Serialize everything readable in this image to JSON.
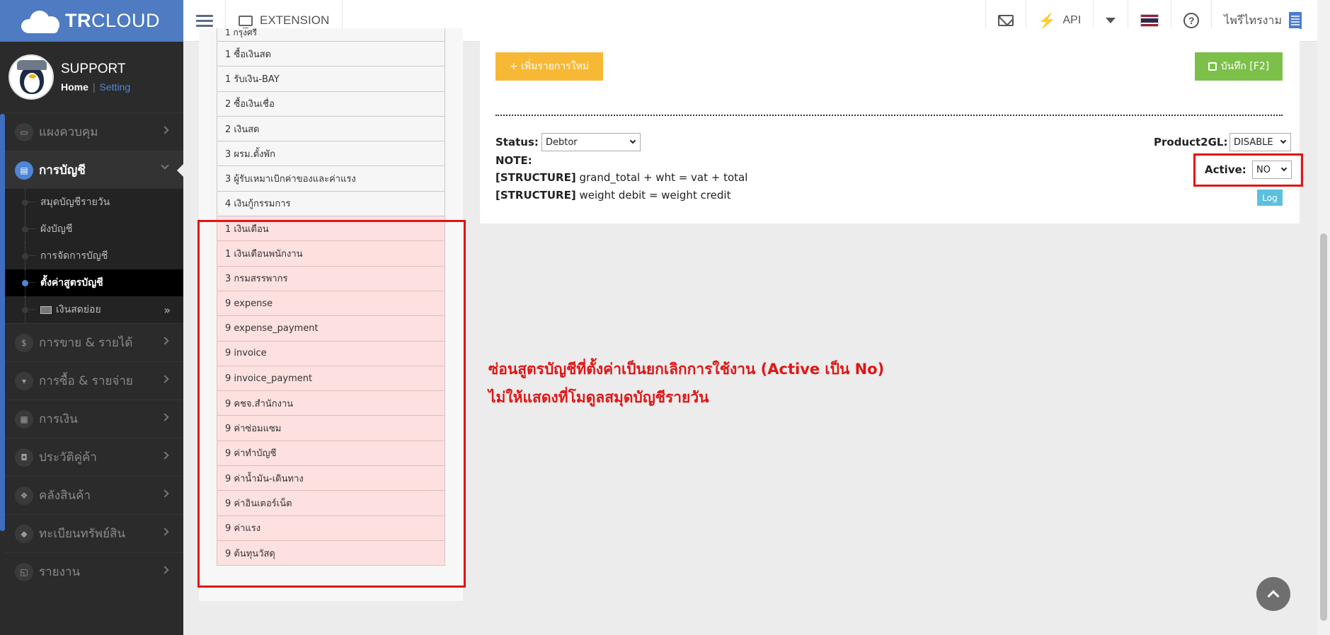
{
  "brand": {
    "bold": "TR",
    "light": "CLOUD"
  },
  "topbar": {
    "extension_label": "EXTENSION",
    "api_label": "API",
    "user_label": "ไพรีไทรงาม",
    "flag_colors": [
      "#a51931",
      "#f4f5f8",
      "#2d2a4a",
      "#f4f5f8",
      "#a51931"
    ]
  },
  "profile": {
    "name": "SUPPORT",
    "home": "Home",
    "separator": "|",
    "setting": "Setting"
  },
  "sidebar": {
    "items": [
      {
        "label": "แผงควบคุม",
        "icon": "monitor-icon",
        "glyph": "▭"
      },
      {
        "label": "การบัญชี",
        "icon": "book-icon",
        "glyph": "▤"
      },
      {
        "label": "การขาย & รายได้",
        "icon": "dollar-icon",
        "glyph": "$"
      },
      {
        "label": "การซื้อ & รายจ่าย",
        "icon": "cart-icon",
        "glyph": "▾"
      },
      {
        "label": "การเงิน",
        "icon": "calendar-icon",
        "glyph": "▦"
      },
      {
        "label": "ประวัติคู่ค้า",
        "icon": "contact-icon",
        "glyph": "◘"
      },
      {
        "label": "คลังสินค้า",
        "icon": "cubes-icon",
        "glyph": "❖"
      },
      {
        "label": "ทะเบียนทรัพย์สิน",
        "icon": "diamond-icon",
        "glyph": "◆"
      },
      {
        "label": "รายงาน",
        "icon": "report-icon",
        "glyph": "◱"
      }
    ],
    "sub_items": [
      {
        "label": "สมุดบัญชีรายวัน"
      },
      {
        "label": "ผังบัญชี"
      },
      {
        "label": "การจัดการบัญชี"
      },
      {
        "label": "ตั้งค่าสูตรบัญชี"
      },
      {
        "label": "เงินสดย่อย"
      }
    ]
  },
  "formula_list": {
    "partial_top": "1 กรุงศรี",
    "active_items": [
      "1 ซื้อเงินสด",
      "1 รับเงิน-BAY",
      "2 ซื้อเงินเชื่อ",
      "2 เงินสด",
      "3 ผรม.ตั้งพัก",
      "3 ผู้รับเหมาเบิกค่าของและค่าแรง",
      "4 เงินกู้กรรมการ"
    ],
    "inactive_items": [
      "1 เงินเดือน",
      "1 เงินเดือนพนักงาน",
      "3 กรมสรรพากร",
      "9 expense",
      "9 expense_payment",
      "9 invoice",
      "9 invoice_payment",
      "9 คชจ.สำนักงาน",
      "9 ค่าซ่อมแซม",
      "9 ค่าทำบัญชี",
      "9 ค่าน้ำมัน-เดินทาง",
      "9 ค่าอินเตอร์เน็ต",
      "9 ค่าแรง",
      "9 ต้นทุนวัสดุ"
    ]
  },
  "form": {
    "add_button": "+ เพิ่มรายการใหม่",
    "save_button": "บันทึก [F2]",
    "status_label": "Status:",
    "status_value": "Debtor",
    "product2gl_label": "Product2GL:",
    "product2gl_value": "DISABLE",
    "active_label": "Active:",
    "active_value": "NO",
    "note_label": "NOTE:",
    "structure_tag": "[STRUCTURE]",
    "structure_1": "grand_total + wht = vat + total",
    "structure_2": "weight debit = weight credit",
    "log_button": "Log"
  },
  "annotation": {
    "line1": "ซ่อนสูตรบัญชีที่ตั้งค่าเป็นยกเลิกการใช้งาน (Active เป็น No)",
    "line2": "ไม่ให้แสดงที่โมดูลสมุดบัญชีรายวัน",
    "color": "#e01515"
  },
  "colors": {
    "brand_blue": "#4e7bc1",
    "add_yellow": "#f7b935",
    "save_green": "#7cc04a",
    "log_cyan": "#5bc0de",
    "inactive_row": "#fde0e0"
  }
}
